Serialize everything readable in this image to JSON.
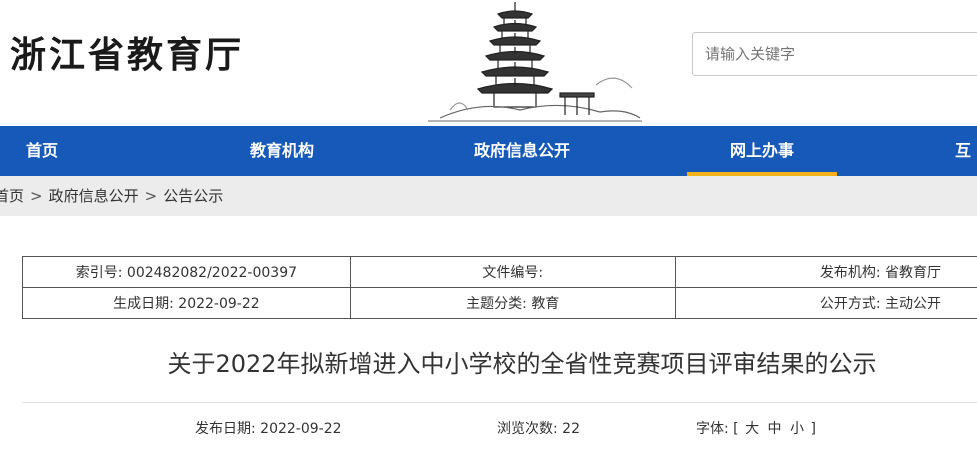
{
  "header": {
    "site_title": "浙江省教育厅",
    "search_placeholder": "请输入关键字"
  },
  "nav": {
    "items": [
      {
        "label": "首页"
      },
      {
        "label": "教育机构"
      },
      {
        "label": "政府信息公开"
      },
      {
        "label": "网上办事",
        "active": true
      },
      {
        "label": "互"
      }
    ],
    "active_underline_color": "#f2b31a",
    "background_color": "#1659b8"
  },
  "breadcrumb": {
    "items": [
      "首页",
      "政府信息公开",
      "公告公示"
    ],
    "separator": ">"
  },
  "info_table": {
    "rows": [
      [
        {
          "label": "索引号:",
          "value": "002482082/2022-00397"
        },
        {
          "label": "文件编号:",
          "value": ""
        },
        {
          "label": "发布机构:",
          "value": "省教育厅"
        }
      ],
      [
        {
          "label": "生成日期:",
          "value": "2022-09-22"
        },
        {
          "label": "主题分类:",
          "value": "教育"
        },
        {
          "label": "公开方式:",
          "value": "主动公开"
        }
      ]
    ]
  },
  "article": {
    "title": "关于2022年拟新增进入中小学校的全省性竞赛项目评审结果的公示",
    "publish_date_label": "发布日期:",
    "publish_date": "2022-09-22",
    "views_label": "浏览次数:",
    "views": "22",
    "font_label": "字体:",
    "font_open": "[",
    "font_large": "大",
    "font_medium": "中",
    "font_small": "小",
    "font_close": "]"
  }
}
